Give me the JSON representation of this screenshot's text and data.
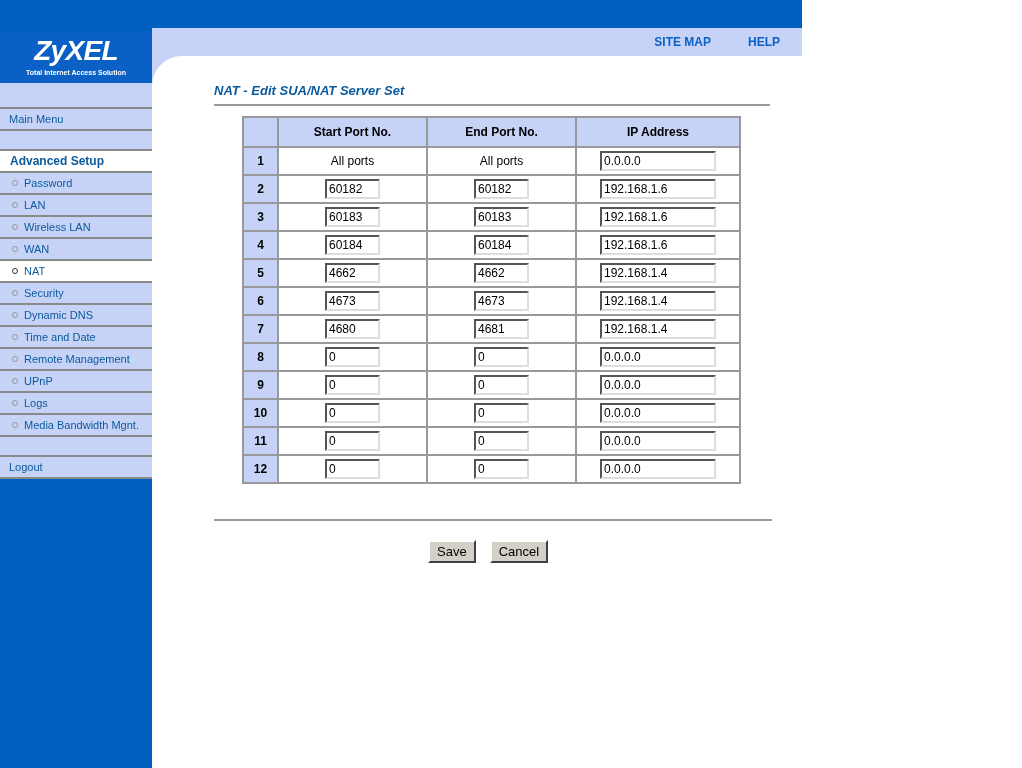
{
  "brand": {
    "name": "ZyXEL",
    "tagline": "Total Internet Access Solution"
  },
  "top_links": [
    "SITE MAP",
    "HELP"
  ],
  "sidebar": {
    "items": [
      {
        "kind": "link",
        "label": "Main Menu"
      },
      {
        "kind": "spacer"
      },
      {
        "kind": "header",
        "label": "Advanced Setup"
      },
      {
        "kind": "item",
        "label": "Password",
        "selected": false
      },
      {
        "kind": "item",
        "label": "LAN",
        "selected": false
      },
      {
        "kind": "item",
        "label": "Wireless LAN",
        "selected": false
      },
      {
        "kind": "item",
        "label": "WAN",
        "selected": false
      },
      {
        "kind": "item",
        "label": "NAT",
        "selected": true
      },
      {
        "kind": "item",
        "label": "Security",
        "selected": false
      },
      {
        "kind": "item",
        "label": "Dynamic DNS",
        "selected": false
      },
      {
        "kind": "item",
        "label": "Time and Date",
        "selected": false
      },
      {
        "kind": "item",
        "label": "Remote Management",
        "selected": false
      },
      {
        "kind": "item",
        "label": "UPnP",
        "selected": false
      },
      {
        "kind": "item",
        "label": "Logs",
        "selected": false
      },
      {
        "kind": "item",
        "label": "Media Bandwidth Mgnt.",
        "selected": false
      },
      {
        "kind": "spacer"
      },
      {
        "kind": "link",
        "label": "Logout"
      }
    ]
  },
  "page_title": "NAT - Edit SUA/NAT Server Set",
  "table": {
    "columns": [
      "Start Port No.",
      "End Port No.",
      "IP Address"
    ],
    "rows": [
      {
        "kind": "fixed",
        "index": "1",
        "start_port": "All ports",
        "end_port": "All ports",
        "ip": "0.0.0.0"
      },
      {
        "kind": "editable",
        "index": "2",
        "start_port": "60182",
        "end_port": "60182",
        "ip": "192.168.1.6"
      },
      {
        "kind": "editable",
        "index": "3",
        "start_port": "60183",
        "end_port": "60183",
        "ip": "192.168.1.6"
      },
      {
        "kind": "editable",
        "index": "4",
        "start_port": "60184",
        "end_port": "60184",
        "ip": "192.168.1.6"
      },
      {
        "kind": "editable",
        "index": "5",
        "start_port": "4662",
        "end_port": "4662",
        "ip": "192.168.1.4"
      },
      {
        "kind": "editable",
        "index": "6",
        "start_port": "4673",
        "end_port": "4673",
        "ip": "192.168.1.4"
      },
      {
        "kind": "editable",
        "index": "7",
        "start_port": "4680",
        "end_port": "4681",
        "ip": "192.168.1.4"
      },
      {
        "kind": "editable",
        "index": "8",
        "start_port": "0",
        "end_port": "0",
        "ip": "0.0.0.0"
      },
      {
        "kind": "editable",
        "index": "9",
        "start_port": "0",
        "end_port": "0",
        "ip": "0.0.0.0"
      },
      {
        "kind": "editable",
        "index": "10",
        "start_port": "0",
        "end_port": "0",
        "ip": "0.0.0.0"
      },
      {
        "kind": "editable",
        "index": "11",
        "start_port": "0",
        "end_port": "0",
        "ip": "0.0.0.0"
      },
      {
        "kind": "editable",
        "index": "12",
        "start_port": "0",
        "end_port": "0",
        "ip": "0.0.0.0"
      }
    ]
  },
  "buttons": [
    "Save",
    "Cancel"
  ]
}
